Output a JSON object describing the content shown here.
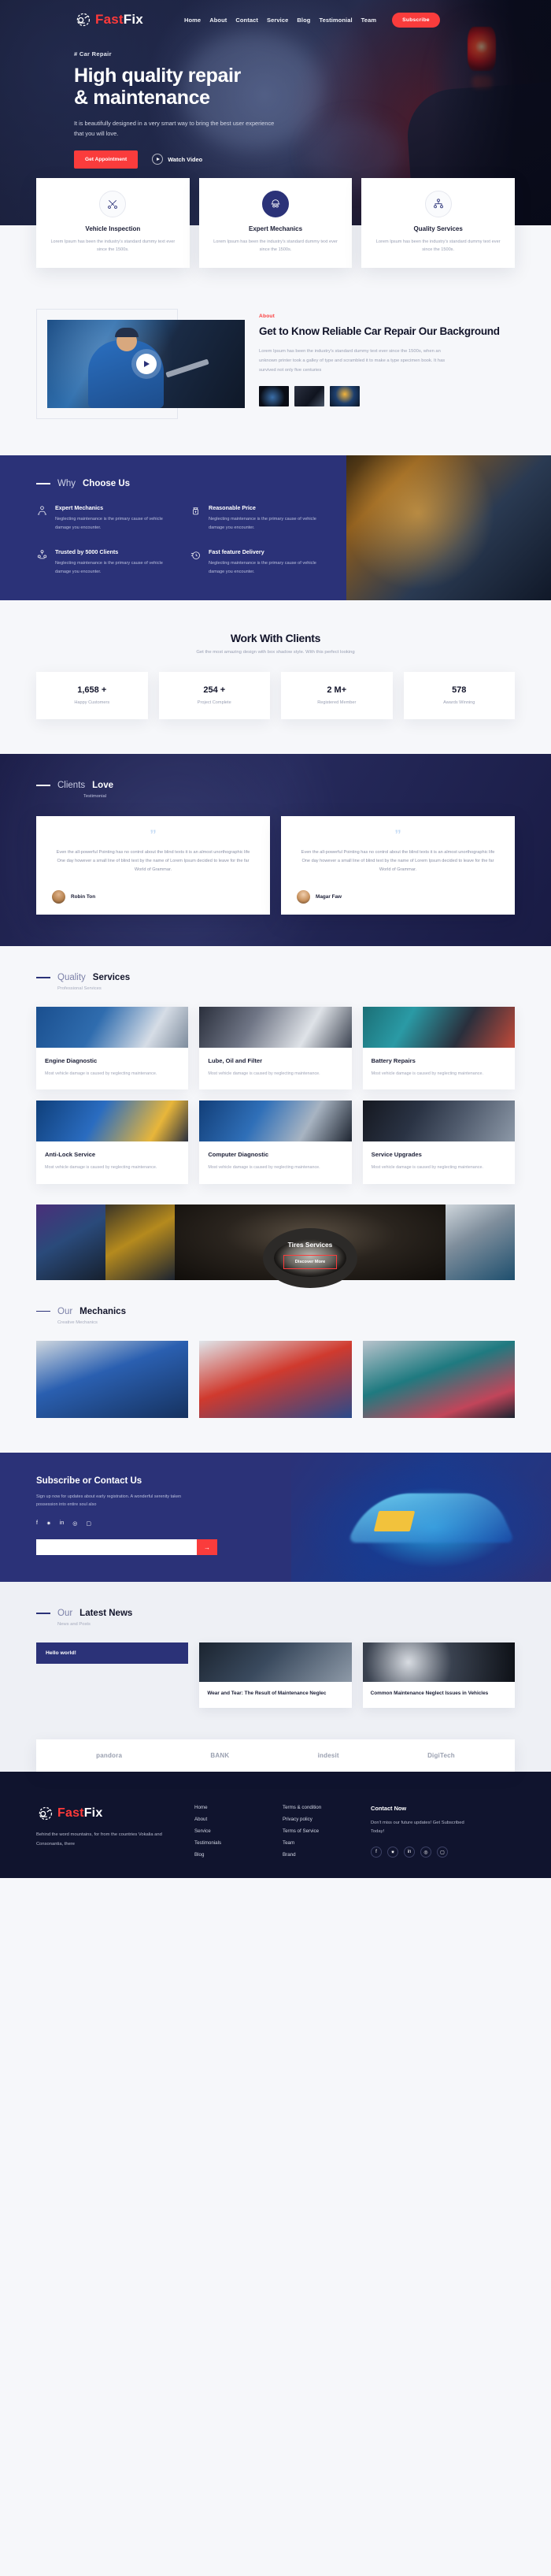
{
  "brand": {
    "name_part1": "Fast",
    "name_part2": "Fix",
    "icon": "gear-car-icon"
  },
  "nav": {
    "items": [
      {
        "label": "Home"
      },
      {
        "label": "About"
      },
      {
        "label": "Contact"
      },
      {
        "label": "Service"
      },
      {
        "label": "Blog"
      },
      {
        "label": "Testimonial"
      },
      {
        "label": "Team"
      }
    ],
    "cta_label": "Subscribe"
  },
  "hero": {
    "eyebrow": "# Car Repair",
    "title_line1": "High quality repair",
    "title_line2": "& maintenance",
    "subtitle": "It is beautifully designed in a very smart way to bring the best user experience that you will love.",
    "primary_button": "Get Appointment",
    "video_label": "Watch Video",
    "accent_color": "#fa3c3c"
  },
  "features": [
    {
      "title": "Vehicle Inspection",
      "desc": "Lorem Ipsum has been the industry's standard dummy text ever since the 1500s.",
      "icon": "tools-cross-icon",
      "active": false
    },
    {
      "title": "Expert Mechanics",
      "desc": "Lorem Ipsum has been the industry's standard dummy text ever since the 1500s.",
      "icon": "mechanic-helmet-icon",
      "active": true
    },
    {
      "title": "Quality Services",
      "desc": "Lorem Ipsum has been the industry's standard dummy text ever since the 1500s.",
      "icon": "team-hierarchy-icon",
      "active": false
    }
  ],
  "about": {
    "tag": "About",
    "heading": "Get to Know Reliable Car Repair Our Background",
    "paragraph": "Lorem Ipsum has been the industry's standard dummy text ever since the 1500s, when an unknown printer took a galley of type and scrambled it to make a type specimen book. It has survived not only five centuries",
    "play_icon": "play-icon",
    "thumbnails": [
      "speedometer-thumb",
      "car-interior-thumb",
      "engine-bay-thumb"
    ]
  },
  "why_choose": {
    "label_light": "Why ",
    "label_bold": "Choose Us",
    "items": [
      {
        "title": "Expert Mechanics",
        "desc": "Neglecting maintenance is the primary cause of vehicle damage you encounter.",
        "icon": "mechanic-team-icon"
      },
      {
        "title": "Reasonable Price",
        "desc": "Neglecting maintenance is the primary cause of vehicle damage you encounter.",
        "icon": "money-bag-icon"
      },
      {
        "title": "Trusted by 5000 Clients",
        "desc": "Neglecting maintenance is the primary cause of vehicle damage you encounter.",
        "icon": "clients-group-icon"
      },
      {
        "title": "Fast feature Delivery",
        "desc": "Neglecting maintenance is the primary cause of vehicle damage you encounter.",
        "icon": "fast-clock-icon"
      }
    ]
  },
  "stats_section": {
    "heading": "Work With Clients",
    "subheading": "Get the most amazing design with box shadow style. With this perfect looking",
    "stats": [
      {
        "value": "1,658 +",
        "label": "Happy Customers"
      },
      {
        "value": "254 +",
        "label": "Project Complete"
      },
      {
        "value": "2 M+",
        "label": "Registered Member"
      },
      {
        "value": "578",
        "label": "Awards Winning"
      }
    ]
  },
  "testimonials": {
    "label_light": "Clients ",
    "label_bold": "Love",
    "subheading": "Testimonial",
    "quote_glyph": "\"",
    "items": [
      {
        "quote": "Even the all-powerful Pointing has no control about the blind texts it is an almost unorthographic life One day however a small line of blind text by the name of Lorem Ipsum decided to leave for the far World of Grammar.",
        "name": "Robin Ton"
      },
      {
        "quote": "Even the all-powerful Pointing has no control about the blind texts it is an almost unorthographic life One day however a small line of blind text by the name of Lorem Ipsum decided to leave for the far World of Grammar.",
        "name": "Magar Faw"
      }
    ]
  },
  "quality_services": {
    "label_light": "Quality ",
    "label_bold": "Services",
    "subheading": "Professional Services",
    "cards": [
      {
        "title": "Engine Diagnostic",
        "desc": "Most vehicle damage is caused by neglecting maintenance."
      },
      {
        "title": "Lube, Oil and Filter",
        "desc": "Most vehicle damage is caused by neglecting maintenance."
      },
      {
        "title": "Battery Repairs",
        "desc": "Most vehicle damage is caused by neglecting maintenance."
      },
      {
        "title": "Anti-Lock Service",
        "desc": "Most vehicle damage is caused by neglecting maintenance."
      },
      {
        "title": "Computer Diagnostic",
        "desc": "Most vehicle damage is caused by neglecting maintenance."
      },
      {
        "title": "Service Upgrades",
        "desc": "Most vehicle damage is caused by neglecting maintenance."
      }
    ]
  },
  "tires": {
    "title": "Tires Services",
    "button": "Discover More"
  },
  "mechanics": {
    "label_light": "Our ",
    "label_bold": "Mechanics",
    "subheading": "Creative Mechanics"
  },
  "subscribe": {
    "heading": "Subscribe or Contact Us",
    "paragraph": "Sign up now for updates about early registration. A wonderful serenity taken possession into entire soul also",
    "socials": [
      "facebook-icon",
      "twitter-icon",
      "linkedin-icon",
      "dribbble-icon",
      "instagram-icon"
    ],
    "social_glyphs": [
      "f",
      "✷",
      "in",
      "◎",
      "▢"
    ],
    "input_placeholder": "",
    "input_value": "",
    "send_icon": "send-arrow-icon"
  },
  "news": {
    "label_light": "Our ",
    "label_bold": "Latest News",
    "subheading": "News and Posts",
    "hello_card": "Hello world!",
    "posts": [
      {
        "title": "Wear and Tear: The Result of Maintenance Neglec"
      },
      {
        "title": "Common Maintenance Neglect Issues in Vehicles"
      }
    ]
  },
  "brands": [
    {
      "name": "pandora"
    },
    {
      "name": "BANK"
    },
    {
      "name": "indesit"
    },
    {
      "name": "DigiTech"
    }
  ],
  "footer": {
    "about": "Behind the word mountains, for from the countries Vokalia and Consonantia, there",
    "links_col1": [
      {
        "label": "Home"
      },
      {
        "label": "About"
      },
      {
        "label": "Service"
      },
      {
        "label": "Testimonials"
      },
      {
        "label": "Blog"
      }
    ],
    "links_col2": [
      {
        "label": "Terms & condition"
      },
      {
        "label": "Privacy policy"
      },
      {
        "label": "Terms of Service"
      },
      {
        "label": "Team"
      },
      {
        "label": "Brand"
      }
    ],
    "contact_title": "Contact Now",
    "contact_text": "Don't miss our future updates! Get Subscribed Today!",
    "social_glyphs": [
      "f",
      "✷",
      "in",
      "◎",
      "▢"
    ]
  }
}
